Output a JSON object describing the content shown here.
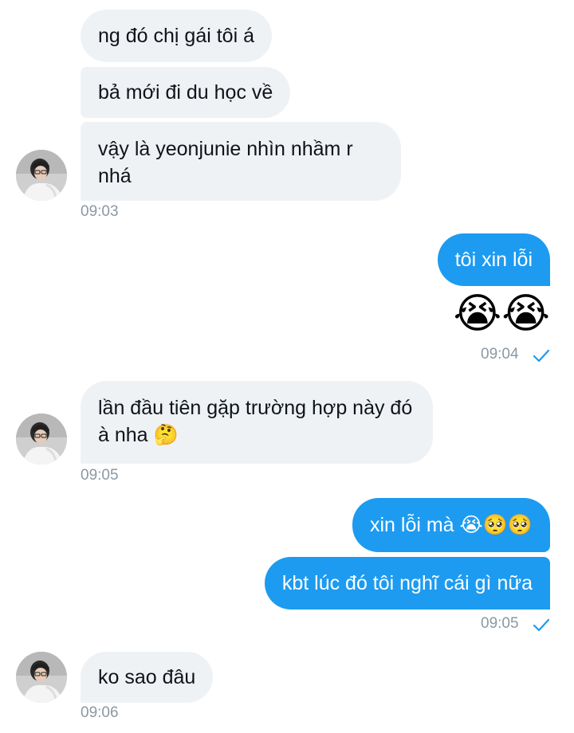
{
  "conversation": {
    "group1": {
      "messages": [
        "ng đó chị gái tôi á",
        "bả mới đi du học về",
        "vậy là yeonjunie nhìn nhầm r nhá"
      ],
      "time": "09:03"
    },
    "group2": {
      "messages": [
        "tôi xin lỗi"
      ],
      "emoji": "😭😭",
      "time": "09:04"
    },
    "group3": {
      "messages": [
        "lần đầu tiên gặp trường hợp này đó à nha 🤔"
      ],
      "time": "09:05"
    },
    "group4": {
      "messages": [
        "xin lỗi mà 😭🥺🥺",
        "kbt lúc đó tôi nghĩ cái gì nữa"
      ],
      "time": "09:05"
    },
    "group5": {
      "messages": [
        "ko sao đâu"
      ],
      "time": "09:06"
    }
  },
  "colors": {
    "sent_bubble": "#1d9bf0",
    "received_bubble": "#eff2f5",
    "timestamp": "#8b98a5",
    "read_check": "#1d9bf0"
  },
  "icons": {
    "avatar": "user-avatar",
    "read_receipt": "checkmark-icon"
  }
}
